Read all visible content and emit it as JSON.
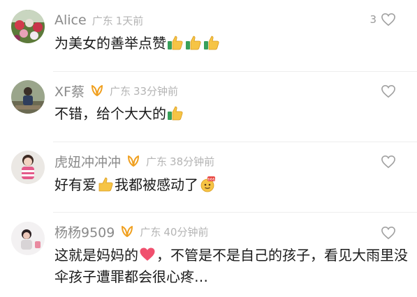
{
  "comments": [
    {
      "user": "Alice",
      "location": "广东",
      "time": "1天前",
      "like_count": "3",
      "text": "为美女的善举点赞",
      "emoji": [
        "thumbs-up-icon",
        "thumbs-up-icon",
        "thumbs-up-icon"
      ]
    },
    {
      "user": "XF蔡",
      "location": "广东",
      "time": "33分钟前",
      "like_count": "",
      "text": "不错，给个大大的",
      "emoji": [
        "thumbs-up-icon"
      ]
    },
    {
      "user": "虎妞冲冲冲",
      "location": "广东",
      "time": "38分钟前",
      "like_count": "",
      "text_before": "好有爱",
      "text_after": "我都被感动了",
      "emoji": [
        "thumbs-up-icon",
        "666-emoji-icon"
      ]
    },
    {
      "user": "杨杨9509",
      "location": "广东",
      "time": "40分钟前",
      "like_count": "",
      "text_before": "这就是妈妈的",
      "text_after": "，不管是不是自己的孩子，看见大雨里没伞孩子遭罪都会很心疼…",
      "emoji": [
        "heart-icon"
      ]
    }
  ],
  "colors": {
    "name": "#8a8a8a",
    "meta": "#b4b4b4",
    "text": "#1a1a1a",
    "badge": "#f0a020",
    "thumb": "#f6c445"
  }
}
